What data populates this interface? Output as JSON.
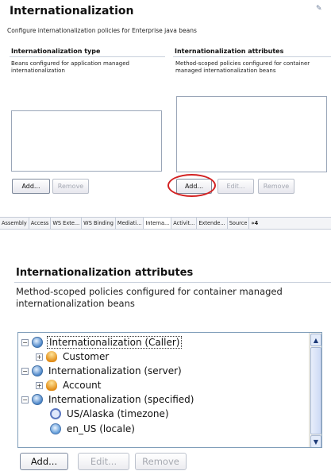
{
  "top": {
    "title": "Internationalization",
    "subtitle": "Configure internationalization policies for Enterprise java beans",
    "left_section": {
      "heading": "Internationalization type",
      "description": "Beans configured for application managed internationalization",
      "buttons": {
        "add": "Add...",
        "remove": "Remove"
      }
    },
    "right_section": {
      "heading": "Internationalization attributes",
      "description": "Method-scoped policies configured for container managed internationalization beans",
      "buttons": {
        "add": "Add...",
        "edit": "Edit...",
        "remove": "Remove"
      }
    }
  },
  "tabs": [
    "Assembly",
    "Access",
    "WS Exte...",
    "WS Binding",
    "Mediati...",
    "Interna...",
    "Activit...",
    "Extende...",
    "Source",
    "»4"
  ],
  "active_tab": "Interna...",
  "zoom": {
    "heading": "Internationalization attributes",
    "description": "Method-scoped policies configured for container managed internationalization beans",
    "tree": [
      {
        "label": "Internationalization (Caller)",
        "expander": "−",
        "icon": "globe-icon"
      },
      {
        "label": "Customer",
        "expander": "+",
        "icon": "user-icon"
      },
      {
        "label": "Internationalization (server)",
        "expander": "−",
        "icon": "globe-icon"
      },
      {
        "label": "Account",
        "expander": "+",
        "icon": "user-icon"
      },
      {
        "label": "Internationalization (specified)",
        "expander": "−",
        "icon": "globe-icon"
      },
      {
        "label": "US/Alaska (timezone)",
        "icon": "timezone-icon"
      },
      {
        "label": "en_US (locale)",
        "icon": "locale-icon"
      }
    ],
    "buttons": {
      "add": "Add...",
      "edit": "Edit...",
      "remove": "Remove"
    }
  },
  "colors": {
    "highlight_circle": "#d32222",
    "section_rule": "#c8d0dc"
  }
}
